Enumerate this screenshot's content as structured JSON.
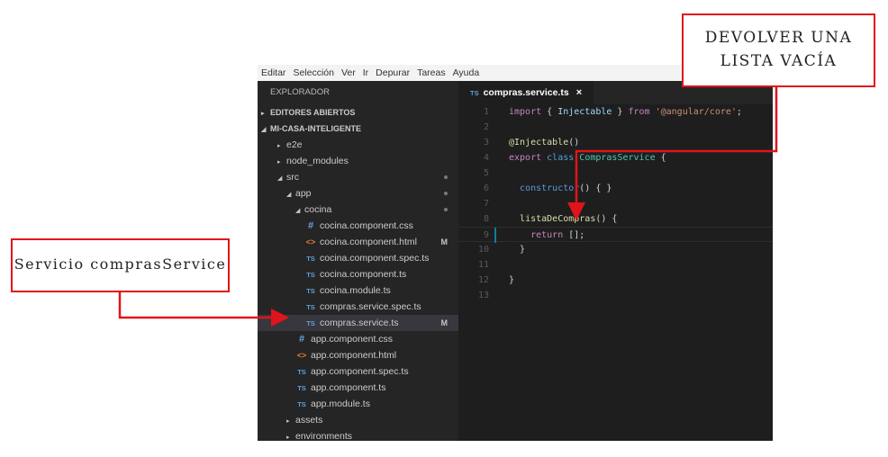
{
  "menubar": [
    "Editar",
    "Selección",
    "Ver",
    "Ir",
    "Depurar",
    "Tareas",
    "Ayuda"
  ],
  "explorer": {
    "header": "EXPLORADOR",
    "rows": [
      {
        "label": "EDITORES ABIERTOS",
        "type": "section",
        "twisty": "▸",
        "indent": 0
      },
      {
        "label": "MI-CASA-INTELIGENTE",
        "type": "section",
        "twisty": "◢",
        "indent": 0
      },
      {
        "label": "e2e",
        "type": "folder",
        "twisty": "▸",
        "indent": 1
      },
      {
        "label": "node_modules",
        "type": "folder",
        "twisty": "▸",
        "indent": 1
      },
      {
        "label": "src",
        "type": "folder",
        "twisty": "◢",
        "indent": 1,
        "dot": true
      },
      {
        "label": "app",
        "type": "folder",
        "twisty": "◢",
        "indent": 2,
        "dot": true
      },
      {
        "label": "cocina",
        "type": "folder",
        "twisty": "◢",
        "indent": 3,
        "dot": true
      },
      {
        "label": "cocina.component.css",
        "type": "css",
        "indent": 4
      },
      {
        "label": "cocina.component.html",
        "type": "html",
        "indent": 4,
        "badge": "M"
      },
      {
        "label": "cocina.component.spec.ts",
        "type": "ts",
        "indent": 4
      },
      {
        "label": "cocina.component.ts",
        "type": "ts",
        "indent": 4
      },
      {
        "label": "cocina.module.ts",
        "type": "ts",
        "indent": 4
      },
      {
        "label": "compras.service.spec.ts",
        "type": "ts",
        "indent": 4
      },
      {
        "label": "compras.service.ts",
        "type": "ts",
        "indent": 4,
        "badge": "M",
        "selected": true
      },
      {
        "label": "app.component.css",
        "type": "css",
        "indent": 3
      },
      {
        "label": "app.component.html",
        "type": "html",
        "indent": 3
      },
      {
        "label": "app.component.spec.ts",
        "type": "ts",
        "indent": 3
      },
      {
        "label": "app.component.ts",
        "type": "ts",
        "indent": 3
      },
      {
        "label": "app.module.ts",
        "type": "ts",
        "indent": 3
      },
      {
        "label": "assets",
        "type": "folder",
        "twisty": "▸",
        "indent": 2
      },
      {
        "label": "environments",
        "type": "folder",
        "twisty": "▸",
        "indent": 2
      }
    ]
  },
  "icons": {
    "ts": "TS",
    "css": "#",
    "html": "<>",
    "close": "×"
  },
  "editor": {
    "tab_label": "compras.service.ts",
    "code_lines": [
      {
        "n": "1",
        "tokens": [
          [
            "kw2",
            "import"
          ],
          [
            "pl",
            " { "
          ],
          [
            "id",
            "Injectable"
          ],
          [
            "pl",
            " } "
          ],
          [
            "kw2",
            "from"
          ],
          [
            "pl",
            " "
          ],
          [
            "str",
            "'@angular/core'"
          ],
          [
            "pl",
            ";"
          ]
        ]
      },
      {
        "n": "2",
        "tokens": []
      },
      {
        "n": "3",
        "tokens": [
          [
            "dec",
            "@Injectable"
          ],
          [
            "pl",
            "()"
          ]
        ]
      },
      {
        "n": "4",
        "tokens": [
          [
            "kw2",
            "export"
          ],
          [
            "pl",
            " "
          ],
          [
            "kw",
            "class"
          ],
          [
            "pl",
            " "
          ],
          [
            "cls",
            "ComprasService"
          ],
          [
            "pl",
            " {"
          ]
        ]
      },
      {
        "n": "5",
        "tokens": []
      },
      {
        "n": "6",
        "tokens": [
          [
            "pl",
            "  "
          ],
          [
            "kw",
            "constructor"
          ],
          [
            "pl",
            "() { }"
          ]
        ]
      },
      {
        "n": "7",
        "tokens": []
      },
      {
        "n": "8",
        "tokens": [
          [
            "pl",
            "  "
          ],
          [
            "fn",
            "listaDeCompras"
          ],
          [
            "pl",
            "() {"
          ]
        ]
      },
      {
        "n": "9",
        "tokens": [
          [
            "pl",
            "    "
          ],
          [
            "kw2",
            "return"
          ],
          [
            "pl",
            " [];"
          ]
        ],
        "active": true
      },
      {
        "n": "10",
        "tokens": [
          [
            "pl",
            "  }"
          ]
        ]
      },
      {
        "n": "11",
        "tokens": []
      },
      {
        "n": "12",
        "tokens": [
          [
            "pl",
            "}"
          ]
        ]
      },
      {
        "n": "13",
        "tokens": []
      }
    ]
  },
  "annotations": {
    "right": "Devolver una lista vacía",
    "left": "Servicio comprasService"
  },
  "colors": {
    "annotation_border": "#e0141b",
    "accent": "#0c7d9d"
  }
}
